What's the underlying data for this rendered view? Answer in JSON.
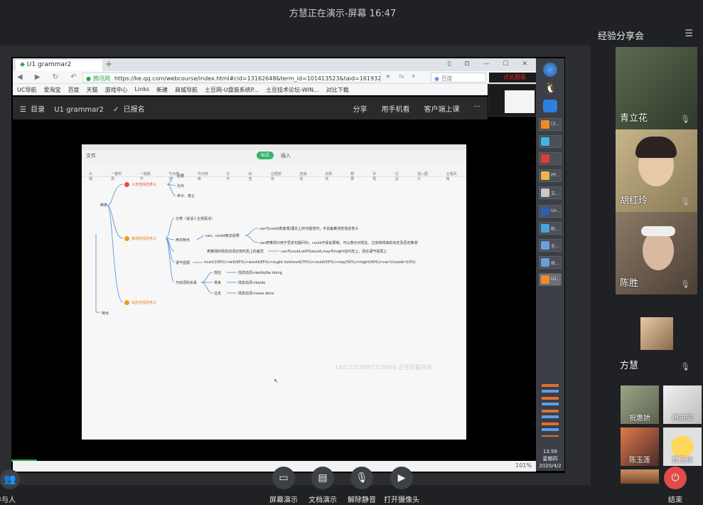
{
  "window": {
    "title": "方慧正在演示-屏幕 16:47",
    "controls": [
      "pin-icon",
      "minimize-icon",
      "maximize-icon",
      "close-icon"
    ]
  },
  "browser": {
    "tab_title": "U1 grammar2",
    "new_tab": "+",
    "url_badge": "腾讯网",
    "url": "https://ke.qq.com/webcourse/index.html#cid=13162648&term_id=101413523&taid=16193297",
    "search_placeholder": "百度",
    "notice": "点此翻看",
    "bookmarks": [
      "UC导航",
      "爱淘宝",
      "百度",
      "天猫",
      "游戏中心",
      "Links",
      "新建",
      "商城导航",
      "土豆网-U盘装系统P...",
      "土豆技术论坛-WIN...",
      "对比下载"
    ]
  },
  "course": {
    "menu_label": "目录",
    "course_name": "U1 grammar2",
    "status": "已报名",
    "actions": [
      "分享",
      "用手机看",
      "客户端上课",
      "···"
    ]
  },
  "doc": {
    "menu_file": "文件",
    "pill": "标式",
    "insert": "插入",
    "toolbar": [
      "大纲",
      "一键布局",
      "一键展开",
      "节点格式",
      "节点搜索",
      "文字",
      "标签",
      "边框颜色",
      "连接线",
      "关联线",
      "概要",
      "外框",
      "过滤",
      "插入图片",
      "主题风格"
    ],
    "watermark": "14011018097325960 正在观看视频"
  },
  "mindmap": {
    "root": "种类",
    "root2": "特点",
    "branch1": "义务性情态意义",
    "b1_children": [
      "必要",
      "允许",
      "命令、禁止"
    ],
    "branch2": "推测性情态意义",
    "b2_cls": "分类（说话人主观看法）",
    "b2_use": "用法特点",
    "b2_can": "can，could用法说明",
    "b2_can1": "can与could表客观/理论上的可能性时，不具备推测性情态意义",
    "b2_can2": "can表推测只用于否定句疑问句，could不受此限制，可以表示对现在、过去和将来的肯定及否定推测",
    "b2_diff": "表推测的情态动词还有时态上的差异",
    "b2_diff_r": "can与could,will与would,may与might在时态上，而在语气强弱上",
    "b2_tone": "语气强弱",
    "b2_tone_r": "must(100%)>will(95%)>would(85%)>ought to/should(75%)>could(55%)>may(50%)>might(40%)>can't/couldn't(0%)",
    "b2_rel": "与动词的关系",
    "b2_now": "现在",
    "b2_now_r": "情态动词+be/do/be doing",
    "b2_fut": "将来",
    "b2_fut_r": "情态动词+be/do",
    "b2_past": "过去",
    "b2_past_r": "情态动词+have done",
    "branch3": "动态性情态意义"
  },
  "taskbar": {
    "items": [
      "(3...",
      "",
      "",
      "PP...",
      "文...",
      "Un...",
      "积...",
      "全...",
      "财...",
      "U1..."
    ],
    "time": "13:56",
    "weekday": "星期四",
    "date": "2020/4/2",
    "zoom": "101%"
  },
  "panel": {
    "title": "经验分享会",
    "participants": [
      {
        "name": "青立花",
        "color": "#4a5540"
      },
      {
        "name": "胡红玲",
        "color": "#8a7a55"
      },
      {
        "name": "陈胜",
        "color": "#6a5a4c"
      },
      {
        "name": "方慧",
        "color": "#1f2124"
      }
    ],
    "small": [
      {
        "name": "祝惠娇",
        "color": "#7f8870"
      },
      {
        "name": "杨振同",
        "color": "#c9c9c9"
      },
      {
        "name": "陈玉莲",
        "color": "#b65a3a"
      },
      {
        "name": "费玉仪",
        "color": "#f0c060"
      },
      {
        "name": "",
        "color": "#b07a4a"
      }
    ]
  },
  "controls": {
    "participants": "参与人",
    "screen_share": "屏幕演示",
    "doc_share": "文档演示",
    "unmute": "解除静音",
    "camera": "打开摄像头",
    "end": "结束"
  }
}
